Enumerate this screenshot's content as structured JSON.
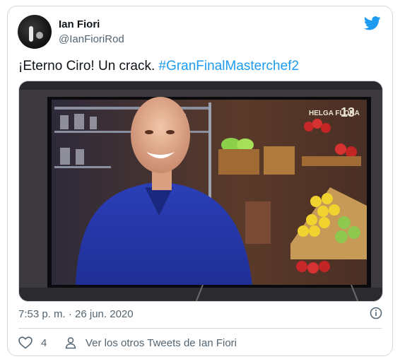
{
  "tweet": {
    "author_name": "Ian Fiori",
    "author_handle": "@IanFioriRod",
    "text_plain": "¡Eterno Ciro! Un crack. ",
    "hashtag": "#GranFinalMasterchef2",
    "timestamp": "7:53 p. m. · 26 jun. 2020",
    "like_count": "4",
    "other_tweets_label": "Ver los otros Tweets de Ian Fiori",
    "media_overlay_text": "HELGA FLORA",
    "media_overlay_number": "13"
  },
  "colors": {
    "brand": "#1d9bf0",
    "text": "#0f1419",
    "secondary": "#536471",
    "border": "#cfd9de"
  },
  "icons": [
    "twitter-bird-icon",
    "info-icon",
    "heart-icon",
    "person-icon"
  ]
}
